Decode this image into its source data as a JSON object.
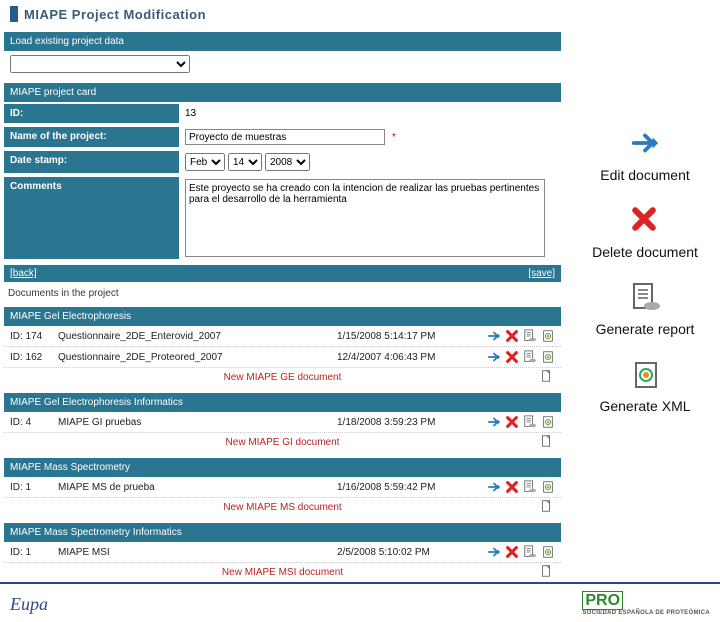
{
  "header": {
    "title": "MIAPE Project Modification"
  },
  "load_section": {
    "label": "Load existing project data"
  },
  "card": {
    "title": "MIAPE project card",
    "id_label": "ID:",
    "id_value": "13",
    "name_label": "Name of the project:",
    "name_value": "Proyecto de muestras",
    "date_label": "Date stamp:",
    "date_month": "Feb",
    "date_day": "14",
    "date_year": "2008",
    "comments_label": "Comments",
    "comments_value": "Este proyecto se ha creado con la intencion de realizar las pruebas pertinentes para el desarrollo de la herramienta"
  },
  "nav": {
    "back": "[back]",
    "save": "[save]"
  },
  "docs_header": "Documents in the project",
  "sections": [
    {
      "title": "MIAPE Gel Electrophoresis",
      "rows": [
        {
          "id_lbl": "ID: 174",
          "name": "Questionnaire_2DE_Enterovid_2007",
          "date": "1/15/2008 5:14:17 PM"
        },
        {
          "id_lbl": "ID: 162",
          "name": "Questionnaire_2DE_Proteored_2007",
          "date": "12/4/2007 4:06:43 PM"
        }
      ],
      "new_link": "New MIAPE GE document"
    },
    {
      "title": "MIAPE Gel Electrophoresis Informatics",
      "rows": [
        {
          "id_lbl": "ID: 4",
          "name": "MIAPE GI pruebas",
          "date": "1/18/2008 3:59:23 PM"
        }
      ],
      "new_link": "New MIAPE GI document"
    },
    {
      "title": "MIAPE Mass Spectrometry",
      "rows": [
        {
          "id_lbl": "ID: 1",
          "name": "MIAPE MS de prueba",
          "date": "1/16/2008 5:59:42 PM"
        }
      ],
      "new_link": "New MIAPE MS document"
    },
    {
      "title": "MIAPE Mass Spectrometry Informatics",
      "rows": [
        {
          "id_lbl": "ID: 1",
          "name": "MIAPE MSI",
          "date": "2/5/2008 5:10:02 PM"
        }
      ],
      "new_link": "New MIAPE MSI document"
    }
  ],
  "side": {
    "edit": "Edit document",
    "delete": "Delete document",
    "report": "Generate report",
    "xml": "Generate XML"
  },
  "footer": {
    "eupa": "Eupa",
    "pro": "PRO",
    "pro_sub": "SOCIEDAD ESPAÑOLA DE PROTEÓMICA"
  }
}
